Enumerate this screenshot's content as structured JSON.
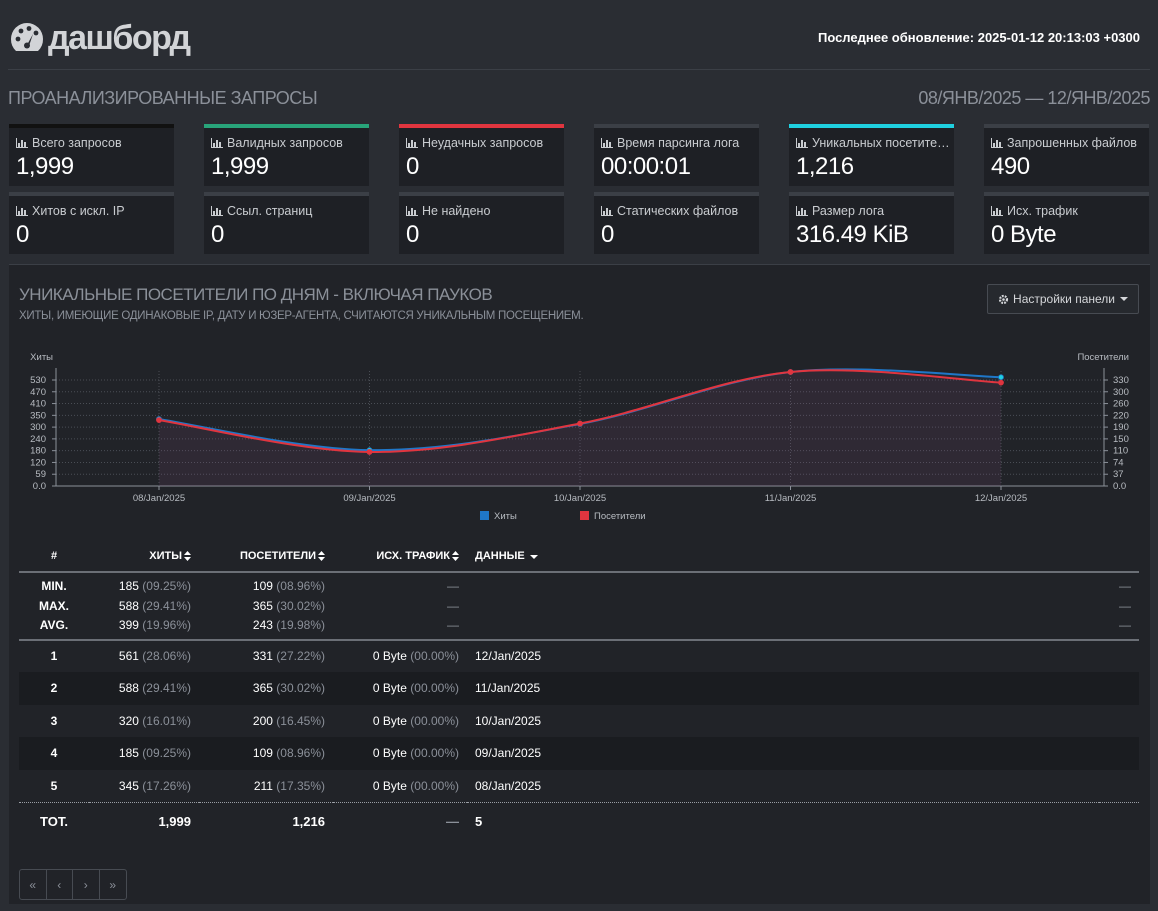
{
  "header": {
    "logo_text": "дашборд",
    "last_updated": "Последнее обновление: 2025-01-12 20:13:03 +0300"
  },
  "section": {
    "title": "ПРОАНАЛИЗИРОВАННЫЕ ЗАПРОСЫ",
    "date_range": "08/ЯНВ/2025 — 12/ЯНВ/2025"
  },
  "cards": [
    {
      "label": "Всего запросов",
      "value": "1,999",
      "color": "#111111"
    },
    {
      "label": "Валидных запросов",
      "value": "1,999",
      "color": "#28a47a"
    },
    {
      "label": "Неудачных запросов",
      "value": "0",
      "color": "#e0353f"
    },
    {
      "label": "Время парсинга лога",
      "value": "00:00:01",
      "color": "#3b3f46"
    },
    {
      "label": "Уникальных посетите…",
      "value": "1,216",
      "color": "#1fd0e0"
    },
    {
      "label": "Запрошенных файлов",
      "value": "490",
      "color": "#3b3f46"
    },
    {
      "label": "Хитов с искл. IP",
      "value": "0",
      "color": "#3b3f46"
    },
    {
      "label": "Ссыл. страниц",
      "value": "0",
      "color": "#3b3f46"
    },
    {
      "label": "Не найдено",
      "value": "0",
      "color": "#3b3f46"
    },
    {
      "label": "Статических файлов",
      "value": "0",
      "color": "#3b3f46"
    },
    {
      "label": "Размер лога",
      "value": "316.49 KiB",
      "color": "#3b3f46"
    },
    {
      "label": "Исх. трафик",
      "value": "0 Byte",
      "color": "#3b3f46"
    }
  ],
  "panel": {
    "title": "УНИКАЛЬНЫЕ ПОСЕТИТЕЛИ ПО ДНЯМ - ВКЛЮЧАЯ ПАУКОВ",
    "subtitle": "ХИТЫ, ИМЕЮЩИЕ ОДИНАКОВЫЕ IP, ДАТУ И ЮЗЕР-АГЕНТА, СЧИТАЮТСЯ УНИКАЛЬНЫМ ПОСЕЩЕНИЕМ.",
    "settings_label": "Настройки панели"
  },
  "chart_data": {
    "type": "area",
    "x": [
      "08/Jan/2025",
      "09/Jan/2025",
      "10/Jan/2025",
      "11/Jan/2025",
      "12/Jan/2025"
    ],
    "series": [
      {
        "name": "Хиты",
        "values": [
          345,
          185,
          320,
          588,
          561
        ],
        "color": "#1f77c8",
        "axis": "left"
      },
      {
        "name": "Посетители",
        "values": [
          211,
          109,
          200,
          365,
          331
        ],
        "color": "#e0353f",
        "axis": "right"
      }
    ],
    "ylabel_left": "Хиты",
    "ylabel_right": "Посетители",
    "yticks_left": [
      "0.0",
      "59",
      "120",
      "180",
      "240",
      "300",
      "350",
      "410",
      "470",
      "530"
    ],
    "yticks_right": [
      "0.0",
      "37",
      "74",
      "110",
      "150",
      "190",
      "220",
      "260",
      "300",
      "330"
    ],
    "ylim_left": [
      0,
      588
    ],
    "ylim_right": [
      0,
      365
    ],
    "grid": true,
    "legend": "bottom"
  },
  "table": {
    "headers": [
      "#",
      "Хиты",
      "Посетители",
      "Исх. трафик",
      "Данные"
    ],
    "stats": [
      {
        "label": "MIN.",
        "hits": "185",
        "hits_pct": "(09.25%)",
        "visitors": "109",
        "visitors_pct": "(08.96%)",
        "traffic": "—",
        "end": "—"
      },
      {
        "label": "MAX.",
        "hits": "588",
        "hits_pct": "(29.41%)",
        "visitors": "365",
        "visitors_pct": "(30.02%)",
        "traffic": "—",
        "end": "—"
      },
      {
        "label": "AVG.",
        "hits": "399",
        "hits_pct": "(19.96%)",
        "visitors": "243",
        "visitors_pct": "(19.98%)",
        "traffic": "—",
        "end": "—"
      }
    ],
    "rows": [
      {
        "n": "1",
        "hits": "561",
        "hits_pct": "(28.06%)",
        "visitors": "331",
        "visitors_pct": "(27.22%)",
        "traffic": "0 Byte",
        "traffic_pct": "(00.00%)",
        "data": "12/Jan/2025"
      },
      {
        "n": "2",
        "hits": "588",
        "hits_pct": "(29.41%)",
        "visitors": "365",
        "visitors_pct": "(30.02%)",
        "traffic": "0 Byte",
        "traffic_pct": "(00.00%)",
        "data": "11/Jan/2025"
      },
      {
        "n": "3",
        "hits": "320",
        "hits_pct": "(16.01%)",
        "visitors": "200",
        "visitors_pct": "(16.45%)",
        "traffic": "0 Byte",
        "traffic_pct": "(00.00%)",
        "data": "10/Jan/2025"
      },
      {
        "n": "4",
        "hits": "185",
        "hits_pct": "(09.25%)",
        "visitors": "109",
        "visitors_pct": "(08.96%)",
        "traffic": "0 Byte",
        "traffic_pct": "(00.00%)",
        "data": "09/Jan/2025"
      },
      {
        "n": "5",
        "hits": "345",
        "hits_pct": "(17.26%)",
        "visitors": "211",
        "visitors_pct": "(17.35%)",
        "traffic": "0 Byte",
        "traffic_pct": "(00.00%)",
        "data": "08/Jan/2025"
      }
    ],
    "total": {
      "label": "TOT.",
      "hits": "1,999",
      "visitors": "1,216",
      "traffic": "—",
      "data": "5"
    }
  },
  "pager": [
    "«",
    "‹",
    "›",
    "»"
  ]
}
